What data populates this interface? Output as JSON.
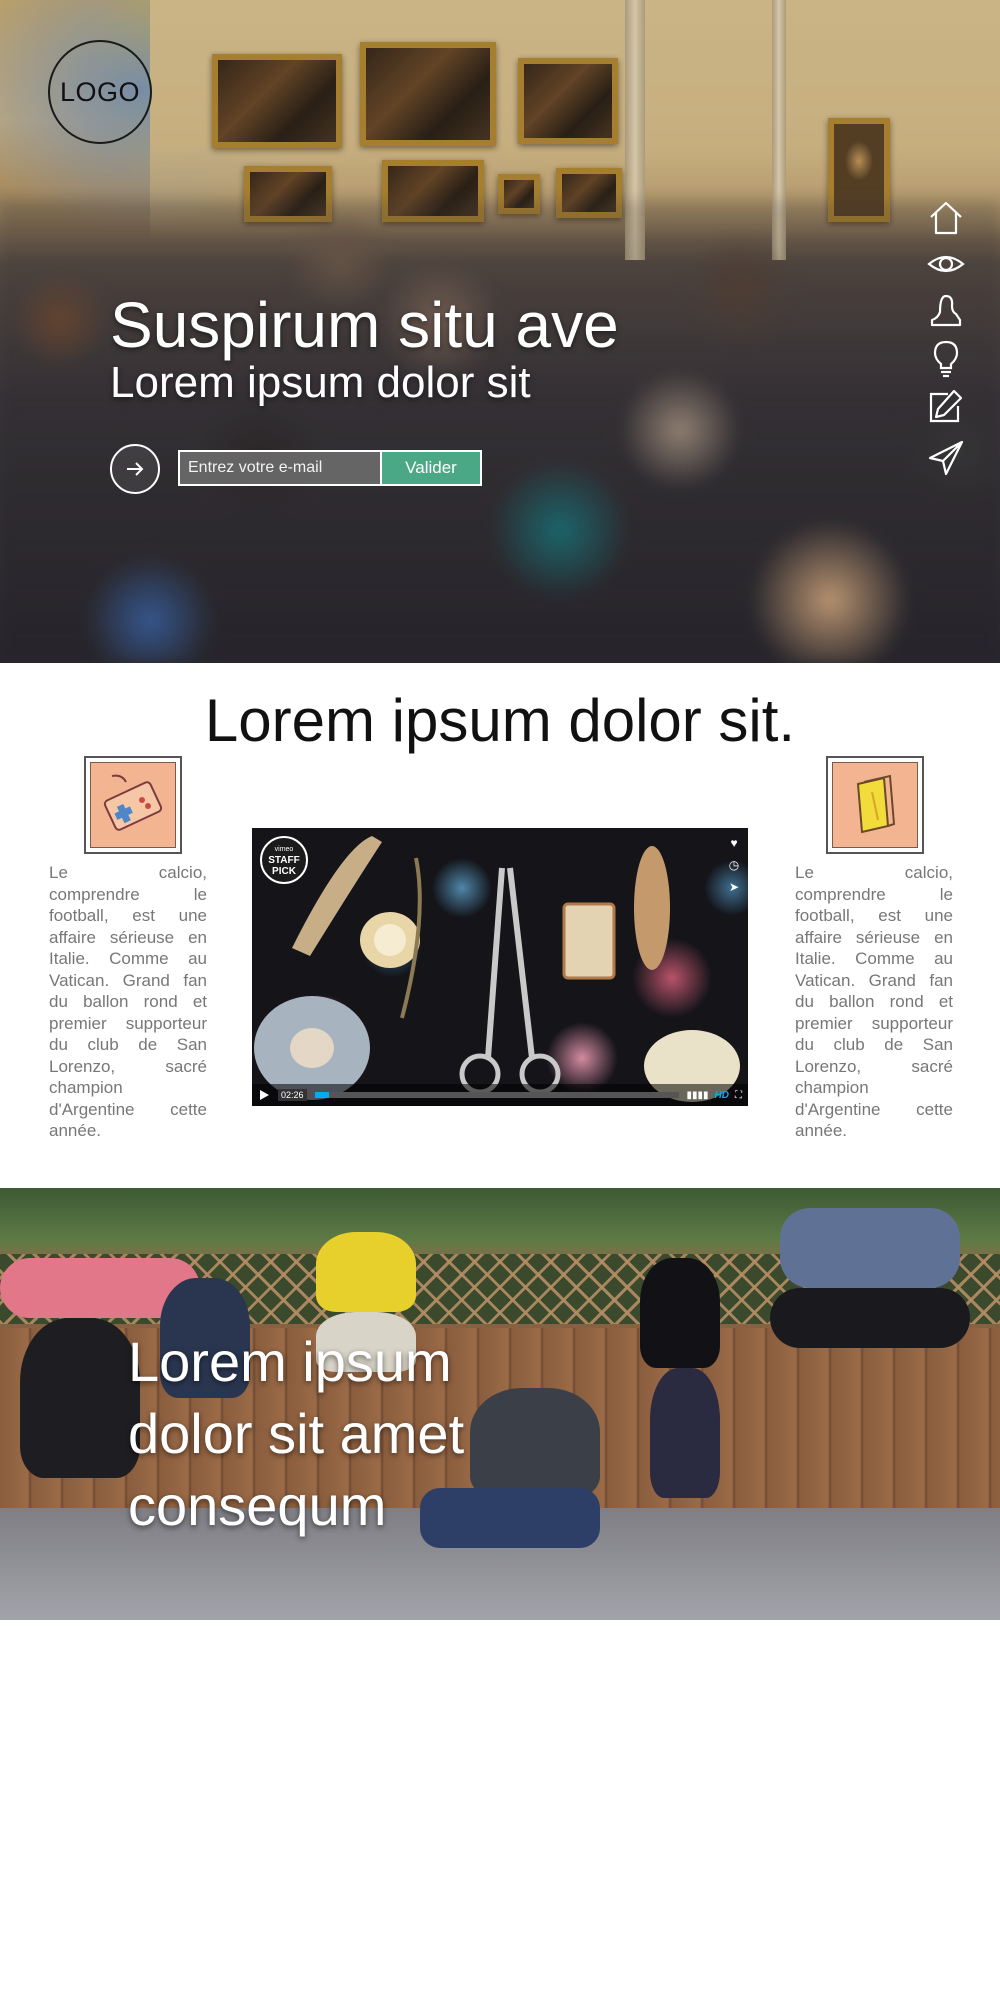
{
  "header": {
    "logo_text": "LOGO",
    "title": "Suspirum situ ave",
    "subtitle": "Lorem ipsum dolor sit",
    "newsletter": {
      "email_placeholder": "Entrez votre e-mail",
      "submit_label": "Valider",
      "submit_color": "#4aa886"
    }
  },
  "side_nav": {
    "items": [
      {
        "icon": "home-icon"
      },
      {
        "icon": "eye-icon"
      },
      {
        "icon": "bust-icon"
      },
      {
        "icon": "lightbulb-icon"
      },
      {
        "icon": "edit-icon"
      },
      {
        "icon": "send-icon"
      }
    ]
  },
  "features": {
    "title": "Lorem ipsum dolor sit.",
    "left": {
      "icon": "game-controller-icon",
      "text": "Le calcio, comprendre le football, est une affaire sérieuse en Italie. Comme au Vatican. Grand fan du ballon rond et premier supporteur du club de San Lorenzo, sacré champion d'Argentine cette année."
    },
    "right": {
      "icon": "book-icon",
      "text": "Le calcio, comprendre le football, est une affaire sérieuse en Italie. Comme au Vatican. Grand fan du ballon rond et premier supporteur du club de San Lorenzo, sacré champion d'Argentine cette année."
    },
    "video": {
      "badge_top": "vimeo",
      "badge_line1": "STAFF",
      "badge_line2": "PICK",
      "time": "02:26",
      "progress": 0.04,
      "hd_label": "HD",
      "accent_color": "#00adef"
    }
  },
  "banner": {
    "title_line1": "Lorem ipsum",
    "title_line2": "dolor sit amet",
    "title_line3": "consequm"
  }
}
